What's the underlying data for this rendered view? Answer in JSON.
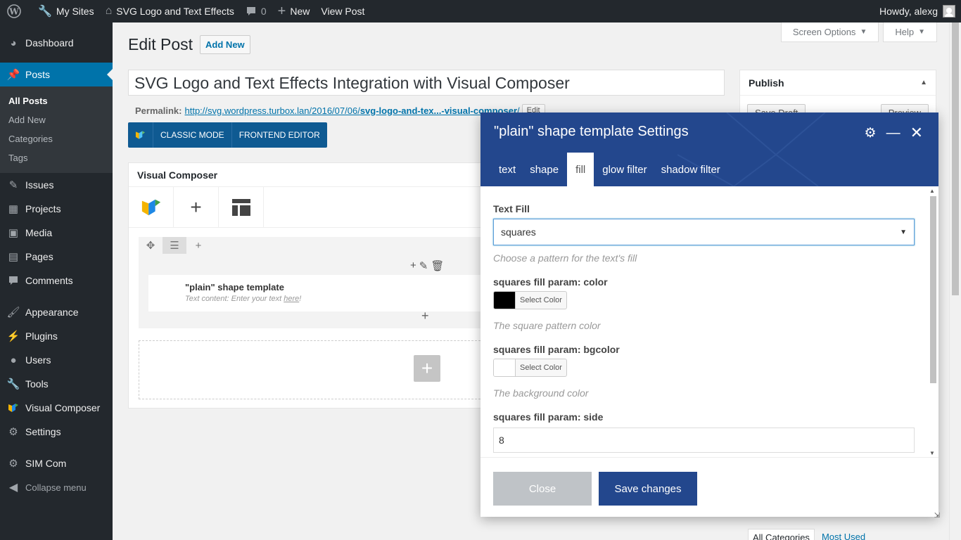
{
  "adminbar": {
    "my_sites": "My Sites",
    "site_name": "SVG Logo and Text Effects",
    "comments_count": "0",
    "new_label": "New",
    "view_post": "View Post",
    "howdy": "Howdy, alexg"
  },
  "menu": {
    "dashboard": "Dashboard",
    "posts": "Posts",
    "posts_sub": [
      "All Posts",
      "Add New",
      "Categories",
      "Tags"
    ],
    "issues": "Issues",
    "projects": "Projects",
    "media": "Media",
    "pages": "Pages",
    "comments": "Comments",
    "appearance": "Appearance",
    "plugins": "Plugins",
    "users": "Users",
    "tools": "Tools",
    "visual_composer": "Visual Composer",
    "settings": "Settings",
    "sim_com": "SIM Com",
    "collapse": "Collapse menu"
  },
  "page": {
    "title": "Edit Post",
    "add_new": "Add New",
    "screen_options": "Screen Options",
    "help": "Help",
    "post_title": "SVG Logo and Text Effects Integration with Visual Composer",
    "permalink_label": "Permalink:",
    "permalink_base": "http://svg.wordpress.turbox.lan/2016/07/06/",
    "permalink_slug": "svg-logo-and-tex...-visual-composer",
    "permalink_end": "/",
    "edit_slug": "Edit",
    "classic_mode": "CLASSIC MODE",
    "frontend_editor": "FRONTEND EDITOR"
  },
  "vc": {
    "title": "Visual Composer",
    "element_title": "\"plain\" shape template",
    "element_sub_prefix": "Text content: Enter your text ",
    "element_sub_link": "here",
    "element_sub_suffix": "!"
  },
  "publish": {
    "title": "Publish",
    "save_draft": "Save Draft",
    "preview": "Preview"
  },
  "categories": {
    "all": "All Categories",
    "most_used": "Most Used"
  },
  "modal": {
    "title": "\"plain\" shape template Settings",
    "tabs": [
      "text",
      "shape",
      "fill",
      "glow filter",
      "shadow filter"
    ],
    "active_tab": "fill",
    "text_fill_label": "Text Fill",
    "text_fill_value": "squares",
    "text_fill_help": "Choose a pattern for the text's fill",
    "color_label": "squares fill param: color",
    "color_value": "#000000",
    "color_button": "Select Color",
    "color_help": "The square pattern color",
    "bgcolor_label": "squares fill param: bgcolor",
    "bgcolor_value": "#ffffff",
    "bgcolor_button": "Select Color",
    "bgcolor_help": "The background color",
    "side_label": "squares fill param: side",
    "side_value": "8",
    "close": "Close",
    "save": "Save changes"
  },
  "colors": {
    "adminbar_bg": "#23282d",
    "menu_active": "#0073aa",
    "modal_accent": "#23478d",
    "vc_blue": "#0f5a92"
  }
}
